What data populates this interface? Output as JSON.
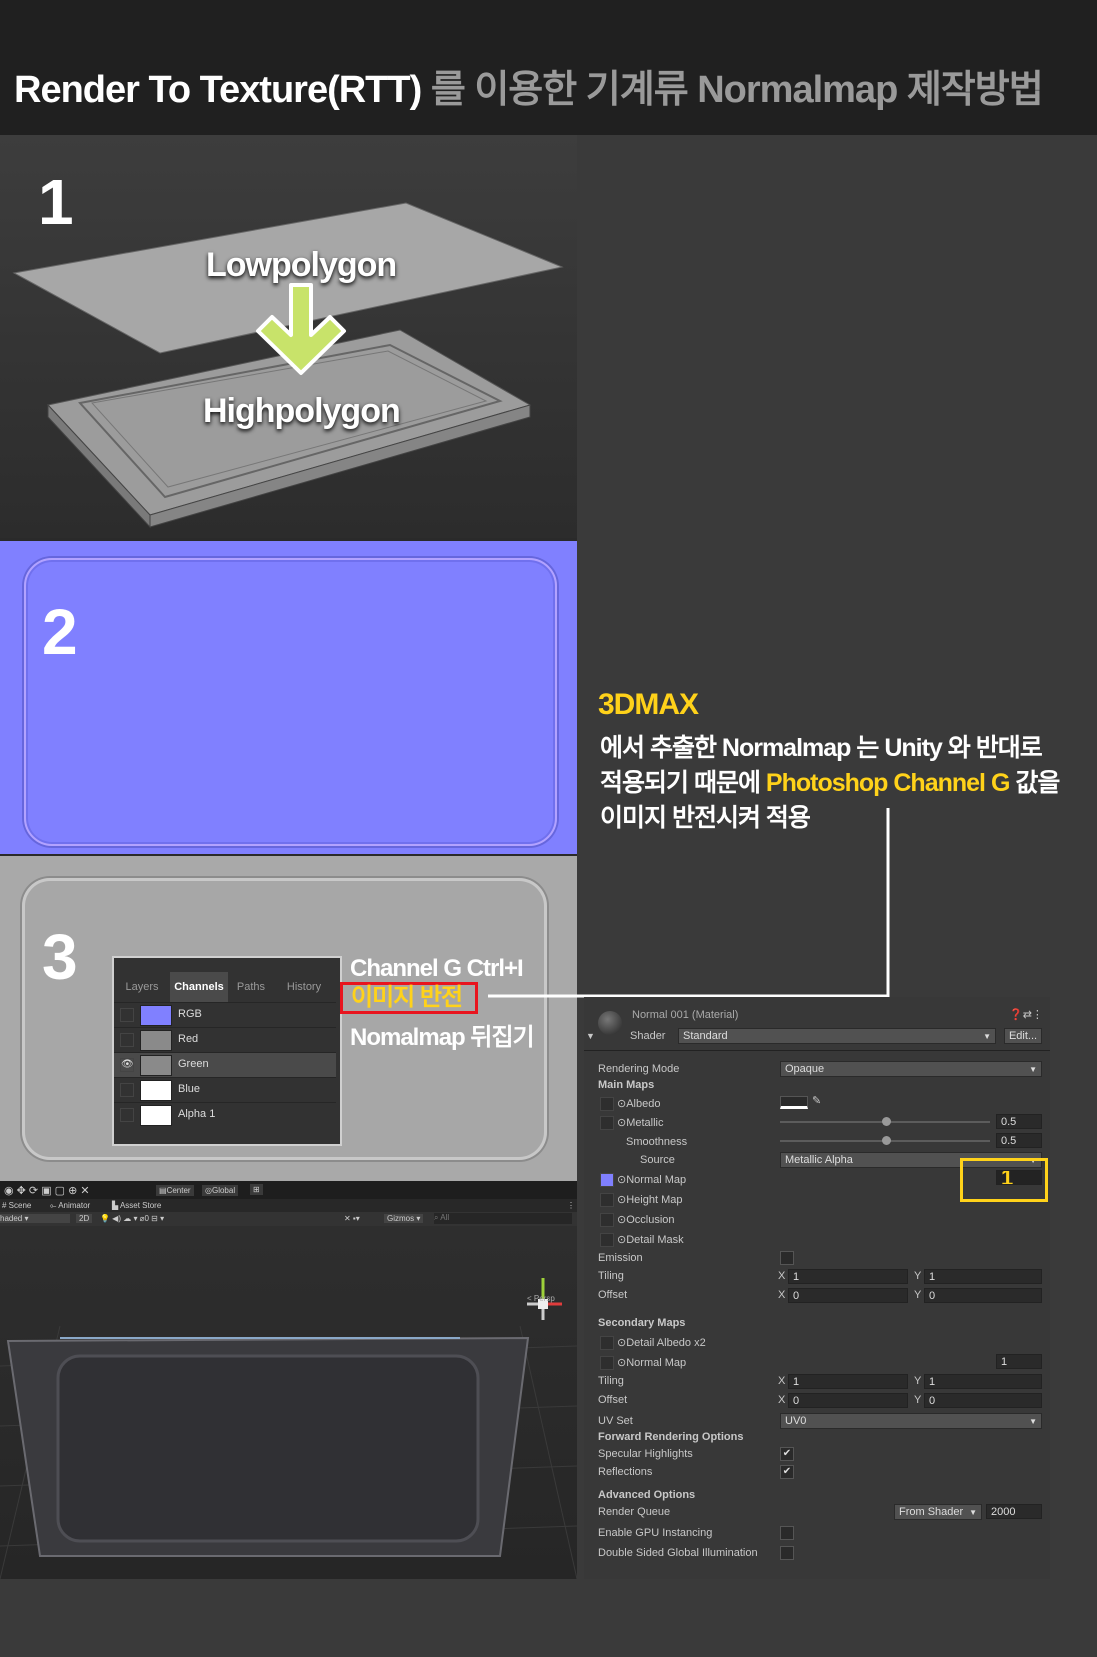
{
  "header": {
    "title_en": "Render To Texture(RTT)",
    "title_kr": "를 이용한 기계류  Normalmap 제작방법"
  },
  "step1": {
    "number": "1",
    "low_label": "Lowpolygon",
    "high_label": "Highpolygon"
  },
  "step2": {
    "number": "2"
  },
  "step3": {
    "number": "3",
    "channels_panel": {
      "tabs": [
        "Layers",
        "Channels",
        "Paths",
        "History"
      ],
      "active_tab": "Channels",
      "channels": [
        {
          "name": "RGB",
          "swatch": "#8080ff",
          "visible": false
        },
        {
          "name": "Red",
          "swatch": "#8a8a8a",
          "visible": false
        },
        {
          "name": "Green",
          "swatch": "#8a8a8a",
          "visible": true
        },
        {
          "name": "Blue",
          "swatch": "#ffffff",
          "visible": false
        },
        {
          "name": "Alpha 1",
          "swatch": "#ffffff",
          "visible": false
        }
      ]
    },
    "annotation_line1": "Channel G  Ctrl+I",
    "annotation_highlight": "이미지 반전",
    "annotation_line3": "Nomalmap 뒤집기"
  },
  "explanation": {
    "heading": "3DMAX",
    "line1": "에서 추출한 Normalmap 는 Unity 와 반대로",
    "line2_a": "적용되기 때문에 ",
    "line2_b": "Photoshop Channel G",
    "line2_c": " 값을",
    "line3": "이미지 반전시켜 적용"
  },
  "scene_toolbar": {
    "center": "Center",
    "global": "Global",
    "tabs": [
      "Scene",
      "Animator",
      "Asset Store"
    ],
    "shading": "haded",
    "mode_2d": "2D",
    "gizmos": "Gizmos",
    "search_placeholder": "All",
    "persp": "< Persp"
  },
  "inspector": {
    "material_name": "Normal 001 (Material)",
    "shader_label": "Shader",
    "shader_value": "Standard",
    "edit_button": "Edit...",
    "rendering_mode_label": "Rendering Mode",
    "rendering_mode_value": "Opaque",
    "main_maps": "Main Maps",
    "albedo": "Albedo",
    "metallic": "Metallic",
    "metallic_value": "0.5",
    "smoothness": "Smoothness",
    "smoothness_value": "0.5",
    "source": "Source",
    "source_value": "Metallic Alpha",
    "normal_map": "Normal Map",
    "normal_scale": "1",
    "height_map": "Height Map",
    "occlusion": "Occlusion",
    "detail_mask": "Detail Mask",
    "emission": "Emission",
    "tiling": "Tiling",
    "offset": "Offset",
    "tiling_x": "1",
    "tiling_y": "1",
    "offset_x": "0",
    "offset_y": "0",
    "x": "X",
    "y": "Y",
    "secondary_maps": "Secondary Maps",
    "detail_albedo": "Detail Albedo x2",
    "sec_normal_map": "Normal Map",
    "sec_normal_scale": "1",
    "sec_tiling_x": "1",
    "sec_tiling_y": "1",
    "sec_offset_x": "0",
    "sec_offset_y": "0",
    "uv_set": "UV Set",
    "uv_set_value": "UV0",
    "forward_options": "Forward Rendering Options",
    "specular_highlights": "Specular Highlights",
    "reflections": "Reflections",
    "advanced_options": "Advanced Options",
    "render_queue": "Render Queue",
    "render_queue_source": "From Shader",
    "render_queue_value": "2000",
    "gpu_instancing": "Enable GPU Instancing",
    "double_sided_gi": "Double Sided Global Illumination"
  },
  "colors": {
    "accent_yellow": "#ffd21a",
    "highlight_red": "#e8141e",
    "normalmap_blue": "#8080ff"
  }
}
